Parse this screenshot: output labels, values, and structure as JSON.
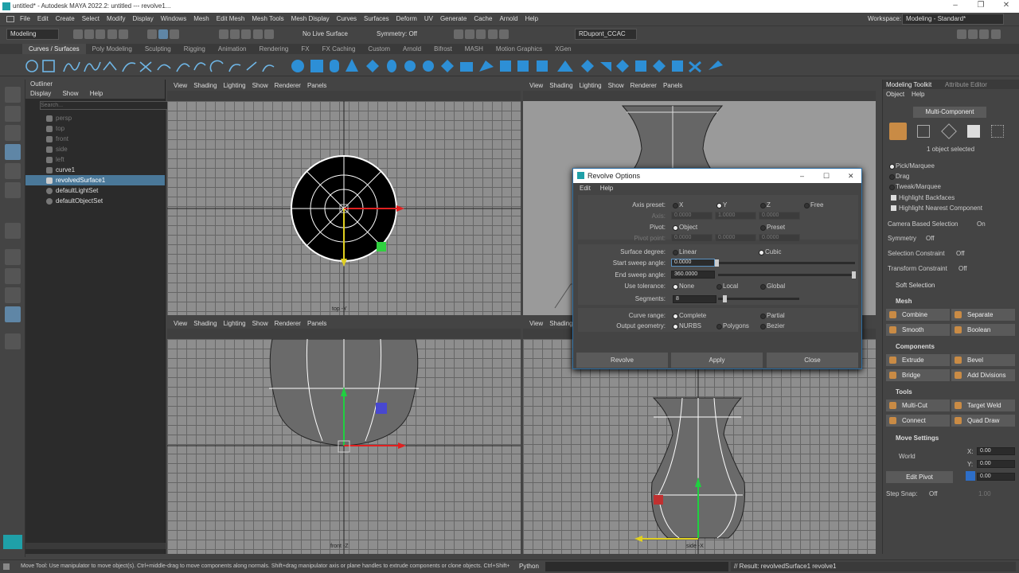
{
  "window": {
    "title": "untitled* - Autodesk MAYA 2022.2: untitled   ---   revolve1..."
  },
  "menubar": {
    "items": [
      "File",
      "Edit",
      "Create",
      "Select",
      "Modify",
      "Display",
      "Windows",
      "Mesh",
      "Edit Mesh",
      "Mesh Tools",
      "Mesh Display",
      "Curves",
      "Surfaces",
      "Deform",
      "UV",
      "Generate",
      "Cache",
      "Arnold",
      "Help"
    ],
    "workspace_label": "Workspace:",
    "workspace_value": "Modeling - Standard*"
  },
  "statusline": {
    "mode": "Modeling",
    "live_surface": "No Live Surface",
    "symmetry": "Symmetry: Off",
    "user": "RDupont_CCAC"
  },
  "shelf": {
    "tabs": [
      "Curves / Surfaces",
      "Poly Modeling",
      "Sculpting",
      "Rigging",
      "Animation",
      "Rendering",
      "FX",
      "FX Caching",
      "Custom",
      "Arnold",
      "Bifrost",
      "MASH",
      "Motion Graphics",
      "XGen"
    ],
    "active_tab": "Curves / Surfaces"
  },
  "outliner": {
    "title": "Outliner",
    "menu": [
      "Display",
      "Show",
      "Help"
    ],
    "search_placeholder": "Search...",
    "items": [
      {
        "label": "persp",
        "kind": "camera"
      },
      {
        "label": "top",
        "kind": "camera"
      },
      {
        "label": "front",
        "kind": "camera"
      },
      {
        "label": "side",
        "kind": "camera"
      },
      {
        "label": "left",
        "kind": "camera"
      },
      {
        "label": "curve1",
        "kind": "curve"
      },
      {
        "label": "revolvedSurface1",
        "kind": "surface",
        "selected": true
      },
      {
        "label": "defaultLightSet",
        "kind": "set"
      },
      {
        "label": "defaultObjectSet",
        "kind": "set"
      }
    ]
  },
  "viewport_menu": [
    "View",
    "Shading",
    "Lighting",
    "Show",
    "Renderer",
    "Panels"
  ],
  "viewports": {
    "top_label": "top -Y",
    "front_label": "front -Z",
    "side_label": "side -X"
  },
  "dialog": {
    "title": "Revolve Options",
    "menu": [
      "Edit",
      "Help"
    ],
    "axis_preset": {
      "label": "Axis preset:",
      "options": [
        "X",
        "Y",
        "Z",
        "Free"
      ],
      "selected": "Y"
    },
    "axis": {
      "label": "Axis:",
      "values": [
        "0.0000",
        "1.0000",
        "0.0000"
      ]
    },
    "pivot": {
      "label": "Pivot:",
      "options": [
        "Object",
        "Preset"
      ],
      "selected": "Object"
    },
    "pivot_point": {
      "label": "Pivot point:",
      "values": [
        "0.0000",
        "0.0000",
        "0.0000"
      ]
    },
    "surface_degree": {
      "label": "Surface degree:",
      "options": [
        "Linear",
        "Cubic"
      ],
      "selected": "Cubic"
    },
    "start_sweep": {
      "label": "Start sweep angle:",
      "value": "0.0000"
    },
    "end_sweep": {
      "label": "End sweep angle:",
      "value": "360.0000"
    },
    "use_tolerance": {
      "label": "Use tolerance:",
      "options": [
        "None",
        "Local",
        "Global"
      ],
      "selected": "None"
    },
    "segments": {
      "label": "Segments:",
      "value": "8"
    },
    "curve_range": {
      "label": "Curve range:",
      "options": [
        "Complete",
        "Partial"
      ],
      "selected": "Complete"
    },
    "output_geometry": {
      "label": "Output geometry:",
      "options": [
        "NURBS",
        "Polygons",
        "Bezier"
      ],
      "selected": "NURBS"
    },
    "buttons": [
      "Revolve",
      "Apply",
      "Close"
    ]
  },
  "toolkit": {
    "tabs": [
      "Modeling Toolkit",
      "Attribute Editor"
    ],
    "menu": [
      "Object",
      "Help"
    ],
    "mode_button": "Multi-Component",
    "selection_info": "1 object selected",
    "options": [
      "Pick/Marquee",
      "Drag",
      "Tweak/Marquee"
    ],
    "checks": [
      "Highlight Backfaces",
      "Highlight Nearest Component"
    ],
    "camera_selection": {
      "label": "Camera Based Selection",
      "value": "On"
    },
    "symmetry": {
      "label": "Symmetry",
      "value": "Off"
    },
    "selection_constraint": {
      "label": "Selection Constraint",
      "value": "Off"
    },
    "transform_constraint": {
      "label": "Transform Constraint",
      "value": "Off"
    },
    "soft_selection": "Soft Selection",
    "sections": {
      "mesh": "Mesh",
      "components": "Components",
      "tools": "Tools",
      "move_settings": "Move Settings"
    },
    "mesh_buttons": [
      "Combine",
      "Separate",
      "Smooth",
      "Boolean"
    ],
    "component_buttons": [
      "Extrude",
      "Bevel",
      "Bridge",
      "Add Divisions"
    ],
    "tool_buttons": [
      "Multi-Cut",
      "Target Weld",
      "Connect",
      "Quad Draw"
    ],
    "move": {
      "space": "World",
      "edit_pivot": "Edit Pivot",
      "x": "0.00",
      "y": "0.00",
      "z": "0.00"
    },
    "step_snap": {
      "label": "Step Snap:",
      "value": "Off",
      "amount": "1.00"
    }
  },
  "statusbar": {
    "help": "Move Tool: Use manipulator to move object(s). Ctrl+middle-drag to move components along normals. Shift+drag manipulator axis or plane handles to extrude components or clone objects. Ctrl+Shift+drag to c",
    "lang": "Python",
    "result": "// Result: revolvedSurface1 revolve1"
  }
}
